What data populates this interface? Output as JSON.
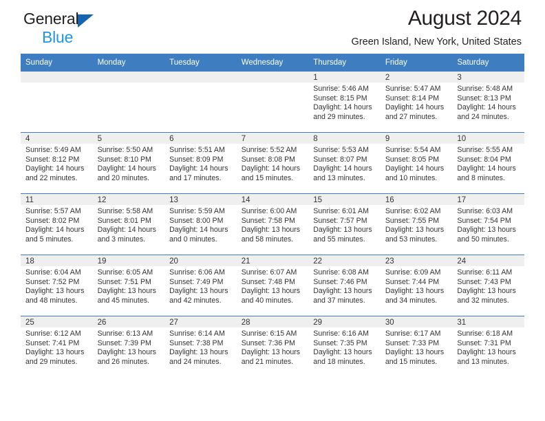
{
  "brand": {
    "name_dark": "General",
    "name_blue": "Blue",
    "triangle_color": "#1565b0",
    "blue_color": "#2196e3"
  },
  "header": {
    "title": "August 2024",
    "subtitle": "Green Island, New York, United States",
    "accent_color": "#3d7dc0",
    "daynum_band_color": "#efefef"
  },
  "calendar": {
    "weekday_headers": [
      "Sunday",
      "Monday",
      "Tuesday",
      "Wednesday",
      "Thursday",
      "Friday",
      "Saturday"
    ],
    "labels": {
      "sunrise": "Sunrise:",
      "sunset": "Sunset:",
      "daylight": "Daylight:"
    },
    "weeks": [
      [
        {
          "day": "",
          "sunrise": "",
          "sunset": "",
          "daylight_line1": "",
          "daylight_line2": ""
        },
        {
          "day": "",
          "sunrise": "",
          "sunset": "",
          "daylight_line1": "",
          "daylight_line2": ""
        },
        {
          "day": "",
          "sunrise": "",
          "sunset": "",
          "daylight_line1": "",
          "daylight_line2": ""
        },
        {
          "day": "",
          "sunrise": "",
          "sunset": "",
          "daylight_line1": "",
          "daylight_line2": ""
        },
        {
          "day": "1",
          "sunrise": "Sunrise: 5:46 AM",
          "sunset": "Sunset: 8:15 PM",
          "daylight_line1": "Daylight: 14 hours",
          "daylight_line2": "and 29 minutes."
        },
        {
          "day": "2",
          "sunrise": "Sunrise: 5:47 AM",
          "sunset": "Sunset: 8:14 PM",
          "daylight_line1": "Daylight: 14 hours",
          "daylight_line2": "and 27 minutes."
        },
        {
          "day": "3",
          "sunrise": "Sunrise: 5:48 AM",
          "sunset": "Sunset: 8:13 PM",
          "daylight_line1": "Daylight: 14 hours",
          "daylight_line2": "and 24 minutes."
        }
      ],
      [
        {
          "day": "4",
          "sunrise": "Sunrise: 5:49 AM",
          "sunset": "Sunset: 8:12 PM",
          "daylight_line1": "Daylight: 14 hours",
          "daylight_line2": "and 22 minutes."
        },
        {
          "day": "5",
          "sunrise": "Sunrise: 5:50 AM",
          "sunset": "Sunset: 8:10 PM",
          "daylight_line1": "Daylight: 14 hours",
          "daylight_line2": "and 20 minutes."
        },
        {
          "day": "6",
          "sunrise": "Sunrise: 5:51 AM",
          "sunset": "Sunset: 8:09 PM",
          "daylight_line1": "Daylight: 14 hours",
          "daylight_line2": "and 17 minutes."
        },
        {
          "day": "7",
          "sunrise": "Sunrise: 5:52 AM",
          "sunset": "Sunset: 8:08 PM",
          "daylight_line1": "Daylight: 14 hours",
          "daylight_line2": "and 15 minutes."
        },
        {
          "day": "8",
          "sunrise": "Sunrise: 5:53 AM",
          "sunset": "Sunset: 8:07 PM",
          "daylight_line1": "Daylight: 14 hours",
          "daylight_line2": "and 13 minutes."
        },
        {
          "day": "9",
          "sunrise": "Sunrise: 5:54 AM",
          "sunset": "Sunset: 8:05 PM",
          "daylight_line1": "Daylight: 14 hours",
          "daylight_line2": "and 10 minutes."
        },
        {
          "day": "10",
          "sunrise": "Sunrise: 5:55 AM",
          "sunset": "Sunset: 8:04 PM",
          "daylight_line1": "Daylight: 14 hours",
          "daylight_line2": "and 8 minutes."
        }
      ],
      [
        {
          "day": "11",
          "sunrise": "Sunrise: 5:57 AM",
          "sunset": "Sunset: 8:02 PM",
          "daylight_line1": "Daylight: 14 hours",
          "daylight_line2": "and 5 minutes."
        },
        {
          "day": "12",
          "sunrise": "Sunrise: 5:58 AM",
          "sunset": "Sunset: 8:01 PM",
          "daylight_line1": "Daylight: 14 hours",
          "daylight_line2": "and 3 minutes."
        },
        {
          "day": "13",
          "sunrise": "Sunrise: 5:59 AM",
          "sunset": "Sunset: 8:00 PM",
          "daylight_line1": "Daylight: 14 hours",
          "daylight_line2": "and 0 minutes."
        },
        {
          "day": "14",
          "sunrise": "Sunrise: 6:00 AM",
          "sunset": "Sunset: 7:58 PM",
          "daylight_line1": "Daylight: 13 hours",
          "daylight_line2": "and 58 minutes."
        },
        {
          "day": "15",
          "sunrise": "Sunrise: 6:01 AM",
          "sunset": "Sunset: 7:57 PM",
          "daylight_line1": "Daylight: 13 hours",
          "daylight_line2": "and 55 minutes."
        },
        {
          "day": "16",
          "sunrise": "Sunrise: 6:02 AM",
          "sunset": "Sunset: 7:55 PM",
          "daylight_line1": "Daylight: 13 hours",
          "daylight_line2": "and 53 minutes."
        },
        {
          "day": "17",
          "sunrise": "Sunrise: 6:03 AM",
          "sunset": "Sunset: 7:54 PM",
          "daylight_line1": "Daylight: 13 hours",
          "daylight_line2": "and 50 minutes."
        }
      ],
      [
        {
          "day": "18",
          "sunrise": "Sunrise: 6:04 AM",
          "sunset": "Sunset: 7:52 PM",
          "daylight_line1": "Daylight: 13 hours",
          "daylight_line2": "and 48 minutes."
        },
        {
          "day": "19",
          "sunrise": "Sunrise: 6:05 AM",
          "sunset": "Sunset: 7:51 PM",
          "daylight_line1": "Daylight: 13 hours",
          "daylight_line2": "and 45 minutes."
        },
        {
          "day": "20",
          "sunrise": "Sunrise: 6:06 AM",
          "sunset": "Sunset: 7:49 PM",
          "daylight_line1": "Daylight: 13 hours",
          "daylight_line2": "and 42 minutes."
        },
        {
          "day": "21",
          "sunrise": "Sunrise: 6:07 AM",
          "sunset": "Sunset: 7:48 PM",
          "daylight_line1": "Daylight: 13 hours",
          "daylight_line2": "and 40 minutes."
        },
        {
          "day": "22",
          "sunrise": "Sunrise: 6:08 AM",
          "sunset": "Sunset: 7:46 PM",
          "daylight_line1": "Daylight: 13 hours",
          "daylight_line2": "and 37 minutes."
        },
        {
          "day": "23",
          "sunrise": "Sunrise: 6:09 AM",
          "sunset": "Sunset: 7:44 PM",
          "daylight_line1": "Daylight: 13 hours",
          "daylight_line2": "and 34 minutes."
        },
        {
          "day": "24",
          "sunrise": "Sunrise: 6:11 AM",
          "sunset": "Sunset: 7:43 PM",
          "daylight_line1": "Daylight: 13 hours",
          "daylight_line2": "and 32 minutes."
        }
      ],
      [
        {
          "day": "25",
          "sunrise": "Sunrise: 6:12 AM",
          "sunset": "Sunset: 7:41 PM",
          "daylight_line1": "Daylight: 13 hours",
          "daylight_line2": "and 29 minutes."
        },
        {
          "day": "26",
          "sunrise": "Sunrise: 6:13 AM",
          "sunset": "Sunset: 7:39 PM",
          "daylight_line1": "Daylight: 13 hours",
          "daylight_line2": "and 26 minutes."
        },
        {
          "day": "27",
          "sunrise": "Sunrise: 6:14 AM",
          "sunset": "Sunset: 7:38 PM",
          "daylight_line1": "Daylight: 13 hours",
          "daylight_line2": "and 24 minutes."
        },
        {
          "day": "28",
          "sunrise": "Sunrise: 6:15 AM",
          "sunset": "Sunset: 7:36 PM",
          "daylight_line1": "Daylight: 13 hours",
          "daylight_line2": "and 21 minutes."
        },
        {
          "day": "29",
          "sunrise": "Sunrise: 6:16 AM",
          "sunset": "Sunset: 7:35 PM",
          "daylight_line1": "Daylight: 13 hours",
          "daylight_line2": "and 18 minutes."
        },
        {
          "day": "30",
          "sunrise": "Sunrise: 6:17 AM",
          "sunset": "Sunset: 7:33 PM",
          "daylight_line1": "Daylight: 13 hours",
          "daylight_line2": "and 15 minutes."
        },
        {
          "day": "31",
          "sunrise": "Sunrise: 6:18 AM",
          "sunset": "Sunset: 7:31 PM",
          "daylight_line1": "Daylight: 13 hours",
          "daylight_line2": "and 13 minutes."
        }
      ]
    ]
  }
}
